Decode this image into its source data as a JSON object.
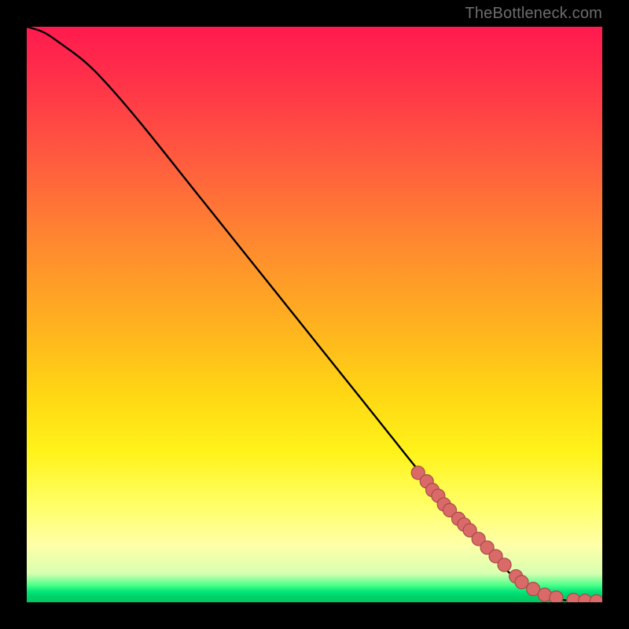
{
  "attribution": "TheBottleneck.com",
  "colors": {
    "dot_fill": "#d96a68",
    "dot_stroke": "#a84a4a",
    "curve": "#000000"
  },
  "chart_data": {
    "type": "line",
    "title": "",
    "xlabel": "",
    "ylabel": "",
    "xlim": [
      0,
      100
    ],
    "ylim": [
      0,
      100
    ],
    "curve": {
      "x": [
        0,
        3,
        6,
        10,
        14,
        20,
        30,
        40,
        50,
        60,
        70,
        78,
        84,
        88,
        92,
        96,
        100
      ],
      "y": [
        100,
        99,
        97,
        94,
        90,
        83,
        70.5,
        58,
        45.5,
        33,
        20.5,
        11,
        5,
        2,
        0.6,
        0.2,
        0.1
      ]
    },
    "series": [
      {
        "name": "points",
        "x": [
          68,
          69.5,
          70.5,
          71.5,
          72.5,
          73.5,
          75,
          76,
          77,
          78.5,
          80,
          81.5,
          83,
          85,
          86,
          88,
          90,
          92,
          95,
          97,
          99
        ],
        "y": [
          22.5,
          21,
          19.5,
          18.5,
          17,
          16,
          14.5,
          13.5,
          12.5,
          11,
          9.5,
          8,
          6.5,
          4.5,
          3.5,
          2.3,
          1.3,
          0.8,
          0.4,
          0.25,
          0.15
        ]
      }
    ]
  }
}
